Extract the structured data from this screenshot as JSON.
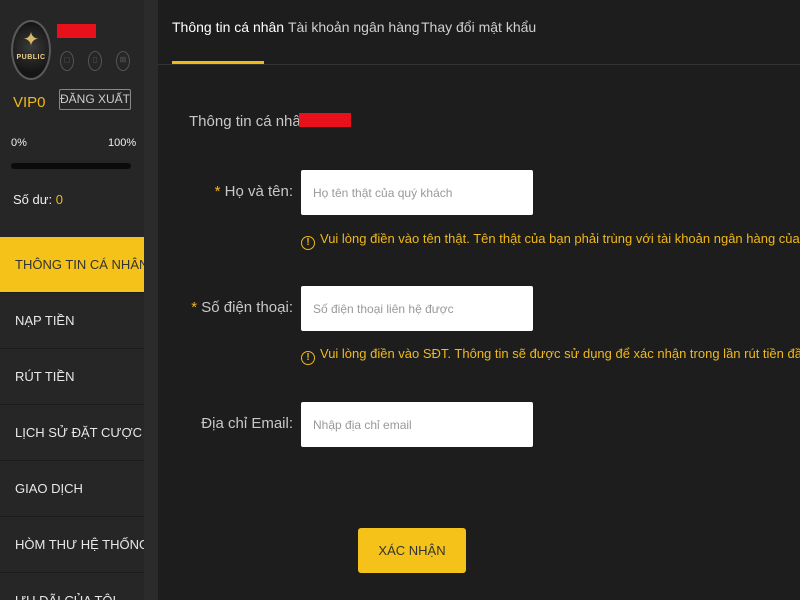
{
  "profile": {
    "brand": "PUBLIC",
    "vip_level": "VIP0",
    "logout_label": "ĐĂNG XUẤT",
    "progress_min": "0%",
    "progress_max": "100%",
    "progress_value": 0,
    "balance_label": "Số dư:",
    "balance_value": "0"
  },
  "sidebar": {
    "items": [
      {
        "label": "THÔNG TIN CÁ NHÂN",
        "active": true
      },
      {
        "label": "NẠP TIỀN",
        "active": false
      },
      {
        "label": "RÚT TIỀN",
        "active": false
      },
      {
        "label": "LỊCH SỬ ĐẶT CƯỢC",
        "active": false
      },
      {
        "label": "GIAO DỊCH",
        "active": false
      },
      {
        "label": "HÒM THƯ HỆ THỐNG",
        "active": false
      },
      {
        "label": "ƯU ĐÃI CỦA TÔI",
        "active": false
      }
    ]
  },
  "tabs": [
    {
      "label": "Thông tin cá nhân",
      "active": true
    },
    {
      "label": "Tài khoản ngân hàng",
      "active": false
    },
    {
      "label": "Thay đổi mật khẩu",
      "active": false
    }
  ],
  "form": {
    "section_title": "Thông tin cá nhân",
    "fullname": {
      "required_mark": "*",
      "label": "Họ và tên:",
      "placeholder": "Họ tên thật của quý khách",
      "value": "",
      "hint": "Vui lòng điền vào tên thật. Tên thật của bạn phải trùng với tài khoản ngân hàng của bạn."
    },
    "phone": {
      "required_mark": "*",
      "label": "Số điện thoại:",
      "placeholder": "Số điện thoại liên hệ được",
      "value": "",
      "hint": "Vui lòng điền vào SĐT. Thông tin sẽ được sử dụng để xác nhận trong lần rút tiền đầu tiên."
    },
    "email": {
      "label": "Địa chỉ Email:",
      "placeholder": "Nhập địa chỉ email",
      "value": ""
    },
    "submit_label": "XÁC NHẬN"
  },
  "colors": {
    "accent": "#f5c21a",
    "sidebar_bg": "#262626",
    "main_bg": "#1d1d1d",
    "redaction": "#e8101a"
  },
  "icons": {
    "hint": "exclamation-circle-icon",
    "avatar": "star-logo-icon",
    "social": [
      "chat-icon",
      "phone-icon",
      "link-icon"
    ]
  }
}
